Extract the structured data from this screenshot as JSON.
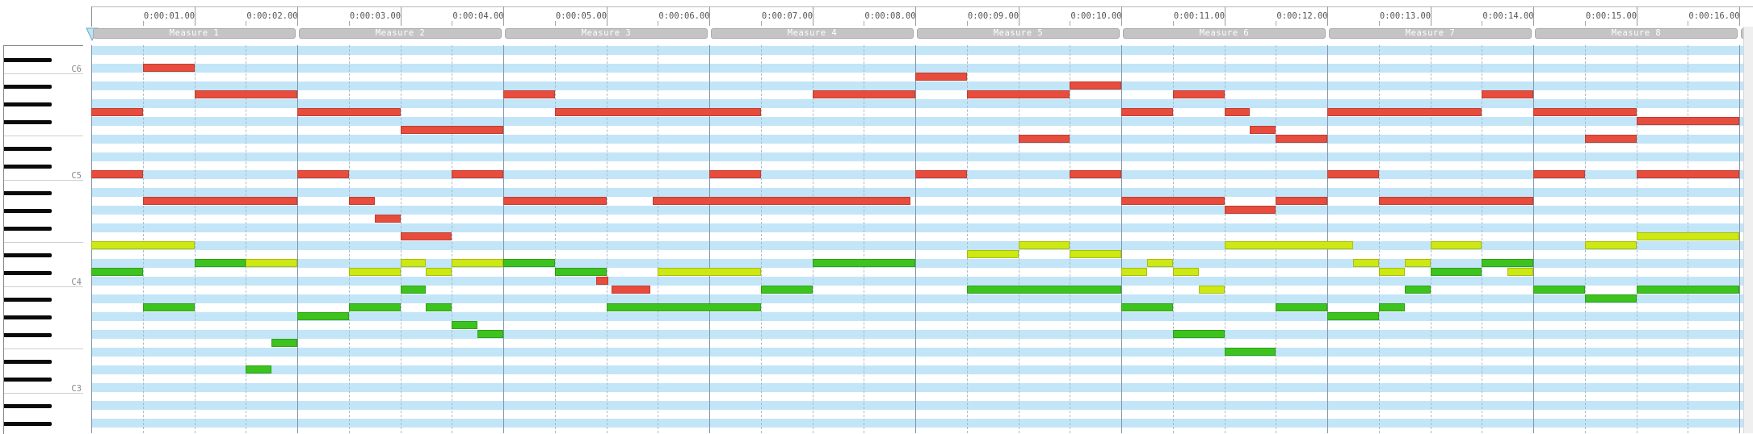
{
  "ruler": {
    "time_labels": [
      "0:00:01.00",
      "0:00:02.00",
      "0:00:03.00",
      "0:00:04.00",
      "0:00:05.00",
      "0:00:06.00",
      "0:00:07.00",
      "0:00:08.00",
      "0:00:09.00",
      "0:00:10.00",
      "0:00:11.00",
      "0:00:12.00",
      "0:00:13.00",
      "0:00:14.00",
      "0:00:15.00",
      "0:00:16.00"
    ]
  },
  "measures": [
    "Measure 1",
    "Measure 2",
    "Measure 3",
    "Measure 4",
    "Measure 5",
    "Measure 6",
    "Measure 7",
    "Measure 8"
  ],
  "keyboard": {
    "octave_labels": [
      "C6",
      "C5",
      "C4",
      "C3"
    ]
  },
  "colors": {
    "note_red": "#e84c3d",
    "note_green": "#3cc31e",
    "note_yellow": "#cde812",
    "row_stripe": "#c3e5f8"
  },
  "notes": [
    {
      "track": "red",
      "start": 0.5,
      "dur": 0.5,
      "pitch": "C6"
    },
    {
      "track": "red",
      "start": 1.0,
      "dur": 1.0,
      "pitch": "A5"
    },
    {
      "track": "red",
      "start": 0.0,
      "dur": 0.5,
      "pitch": "G5"
    },
    {
      "track": "red",
      "start": 0.0,
      "dur": 0.5,
      "pitch": "C5"
    },
    {
      "track": "red",
      "start": 0.5,
      "dur": 1.5,
      "pitch": "A4"
    },
    {
      "track": "red",
      "start": 2.0,
      "dur": 1.0,
      "pitch": "G5"
    },
    {
      "track": "red",
      "start": 3.0,
      "dur": 1.0,
      "pitch": "F5"
    },
    {
      "track": "red",
      "start": 2.0,
      "dur": 0.5,
      "pitch": "C5"
    },
    {
      "track": "red",
      "start": 3.5,
      "dur": 0.5,
      "pitch": "C5"
    },
    {
      "track": "red",
      "start": 2.5,
      "dur": 0.25,
      "pitch": "A4"
    },
    {
      "track": "red",
      "start": 2.75,
      "dur": 0.25,
      "pitch": "G4"
    },
    {
      "track": "red",
      "start": 3.0,
      "dur": 0.5,
      "pitch": "F4"
    },
    {
      "track": "red",
      "start": 4.0,
      "dur": 0.5,
      "pitch": "A5"
    },
    {
      "track": "red",
      "start": 4.5,
      "dur": 2.0,
      "pitch": "G5"
    },
    {
      "track": "red",
      "start": 6.0,
      "dur": 0.5,
      "pitch": "C5"
    },
    {
      "track": "red",
      "start": 4.0,
      "dur": 1.0,
      "pitch": "A4"
    },
    {
      "track": "red",
      "start": 5.45,
      "dur": 2.5,
      "pitch": "A4"
    },
    {
      "track": "red",
      "start": 4.9,
      "dur": 0.12,
      "pitch": "C4"
    },
    {
      "track": "red",
      "start": 5.05,
      "dur": 0.38,
      "pitch": "B3"
    },
    {
      "track": "red",
      "start": 7.0,
      "dur": 1.0,
      "pitch": "A5"
    },
    {
      "track": "red",
      "start": 8.0,
      "dur": 0.5,
      "pitch": "B5"
    },
    {
      "track": "red",
      "start": 8.5,
      "dur": 1.0,
      "pitch": "A5"
    },
    {
      "track": "red",
      "start": 9.5,
      "dur": 0.5,
      "pitch": "A#5"
    },
    {
      "track": "red",
      "start": 9.0,
      "dur": 0.5,
      "pitch": "E5"
    },
    {
      "track": "red",
      "start": 8.0,
      "dur": 0.5,
      "pitch": "C5"
    },
    {
      "track": "red",
      "start": 9.5,
      "dur": 0.5,
      "pitch": "C5"
    },
    {
      "track": "red",
      "start": 10.0,
      "dur": 0.5,
      "pitch": "G5"
    },
    {
      "track": "red",
      "start": 10.5,
      "dur": 0.5,
      "pitch": "A5"
    },
    {
      "track": "red",
      "start": 11.0,
      "dur": 0.25,
      "pitch": "G5"
    },
    {
      "track": "red",
      "start": 11.25,
      "dur": 0.25,
      "pitch": "F5"
    },
    {
      "track": "red",
      "start": 11.5,
      "dur": 0.5,
      "pitch": "E5"
    },
    {
      "track": "red",
      "start": 10.0,
      "dur": 1.0,
      "pitch": "A4"
    },
    {
      "track": "red",
      "start": 11.0,
      "dur": 0.5,
      "pitch": "G#4"
    },
    {
      "track": "red",
      "start": 11.5,
      "dur": 0.5,
      "pitch": "A4"
    },
    {
      "track": "red",
      "start": 12.0,
      "dur": 1.5,
      "pitch": "G5"
    },
    {
      "track": "red",
      "start": 13.5,
      "dur": 0.5,
      "pitch": "A5"
    },
    {
      "track": "red",
      "start": 12.0,
      "dur": 0.5,
      "pitch": "C5"
    },
    {
      "track": "red",
      "start": 12.5,
      "dur": 1.5,
      "pitch": "A4"
    },
    {
      "track": "red",
      "start": 14.0,
      "dur": 1.0,
      "pitch": "G5"
    },
    {
      "track": "red",
      "start": 15.0,
      "dur": 1.0,
      "pitch": "F#5"
    },
    {
      "track": "red",
      "start": 14.5,
      "dur": 0.5,
      "pitch": "E5"
    },
    {
      "track": "red",
      "start": 14.0,
      "dur": 0.5,
      "pitch": "C5"
    },
    {
      "track": "red",
      "start": 15.0,
      "dur": 1.0,
      "pitch": "C5"
    },
    {
      "track": "yellow",
      "start": 0.0,
      "dur": 1.0,
      "pitch": "E4"
    },
    {
      "track": "yellow",
      "start": 1.5,
      "dur": 0.5,
      "pitch": "D4"
    },
    {
      "track": "yellow",
      "start": 2.5,
      "dur": 0.5,
      "pitch": "C#4"
    },
    {
      "track": "yellow",
      "start": 3.0,
      "dur": 0.25,
      "pitch": "D4"
    },
    {
      "track": "yellow",
      "start": 3.25,
      "dur": 0.25,
      "pitch": "C#4"
    },
    {
      "track": "yellow",
      "start": 3.5,
      "dur": 0.5,
      "pitch": "D4"
    },
    {
      "track": "yellow",
      "start": 5.5,
      "dur": 1.0,
      "pitch": "C#4"
    },
    {
      "track": "yellow",
      "start": 8.5,
      "dur": 0.5,
      "pitch": "D#4"
    },
    {
      "track": "yellow",
      "start": 9.0,
      "dur": 0.5,
      "pitch": "E4"
    },
    {
      "track": "yellow",
      "start": 9.5,
      "dur": 0.5,
      "pitch": "D#4"
    },
    {
      "track": "yellow",
      "start": 10.0,
      "dur": 0.25,
      "pitch": "C#4"
    },
    {
      "track": "yellow",
      "start": 10.25,
      "dur": 0.25,
      "pitch": "D4"
    },
    {
      "track": "yellow",
      "start": 10.5,
      "dur": 0.25,
      "pitch": "C#4"
    },
    {
      "track": "yellow",
      "start": 10.75,
      "dur": 0.25,
      "pitch": "B3"
    },
    {
      "track": "yellow",
      "start": 11.0,
      "dur": 1.25,
      "pitch": "E4"
    },
    {
      "track": "yellow",
      "start": 12.25,
      "dur": 0.25,
      "pitch": "D4"
    },
    {
      "track": "yellow",
      "start": 12.5,
      "dur": 0.25,
      "pitch": "C#4"
    },
    {
      "track": "yellow",
      "start": 12.75,
      "dur": 0.25,
      "pitch": "D4"
    },
    {
      "track": "yellow",
      "start": 13.0,
      "dur": 0.5,
      "pitch": "E4"
    },
    {
      "track": "yellow",
      "start": 13.75,
      "dur": 0.25,
      "pitch": "C#4"
    },
    {
      "track": "yellow",
      "start": 14.5,
      "dur": 0.5,
      "pitch": "E4"
    },
    {
      "track": "yellow",
      "start": 15.0,
      "dur": 1.0,
      "pitch": "F4"
    },
    {
      "track": "green",
      "start": 0.0,
      "dur": 0.5,
      "pitch": "C#4"
    },
    {
      "track": "green",
      "start": 1.0,
      "dur": 0.5,
      "pitch": "D4"
    },
    {
      "track": "green",
      "start": 0.5,
      "dur": 0.5,
      "pitch": "A3"
    },
    {
      "track": "green",
      "start": 1.75,
      "dur": 0.25,
      "pitch": "F3"
    },
    {
      "track": "green",
      "start": 1.5,
      "dur": 0.25,
      "pitch": "D3"
    },
    {
      "track": "green",
      "start": 2.0,
      "dur": 0.5,
      "pitch": "G#3"
    },
    {
      "track": "green",
      "start": 2.5,
      "dur": 0.5,
      "pitch": "A3"
    },
    {
      "track": "green",
      "start": 3.0,
      "dur": 0.25,
      "pitch": "B3"
    },
    {
      "track": "green",
      "start": 3.25,
      "dur": 0.25,
      "pitch": "A3"
    },
    {
      "track": "green",
      "start": 3.5,
      "dur": 0.25,
      "pitch": "G3"
    },
    {
      "track": "green",
      "start": 3.75,
      "dur": 0.25,
      "pitch": "F#3"
    },
    {
      "track": "green",
      "start": 4.0,
      "dur": 0.5,
      "pitch": "D4"
    },
    {
      "track": "green",
      "start": 4.5,
      "dur": 0.5,
      "pitch": "C#4"
    },
    {
      "track": "green",
      "start": 5.0,
      "dur": 1.5,
      "pitch": "A3"
    },
    {
      "track": "green",
      "start": 6.5,
      "dur": 0.5,
      "pitch": "B3"
    },
    {
      "track": "green",
      "start": 7.0,
      "dur": 1.0,
      "pitch": "D4"
    },
    {
      "track": "green",
      "start": 8.5,
      "dur": 1.5,
      "pitch": "B3"
    },
    {
      "track": "green",
      "start": 10.0,
      "dur": 0.5,
      "pitch": "A3"
    },
    {
      "track": "green",
      "start": 10.5,
      "dur": 0.5,
      "pitch": "F#3"
    },
    {
      "track": "green",
      "start": 11.0,
      "dur": 0.5,
      "pitch": "E3"
    },
    {
      "track": "green",
      "start": 11.5,
      "dur": 0.5,
      "pitch": "A3"
    },
    {
      "track": "green",
      "start": 12.0,
      "dur": 0.5,
      "pitch": "G#3"
    },
    {
      "track": "green",
      "start": 12.5,
      "dur": 0.25,
      "pitch": "A3"
    },
    {
      "track": "green",
      "start": 12.75,
      "dur": 0.25,
      "pitch": "B3"
    },
    {
      "track": "green",
      "start": 13.0,
      "dur": 0.5,
      "pitch": "C#4"
    },
    {
      "track": "green",
      "start": 13.5,
      "dur": 0.5,
      "pitch": "D4"
    },
    {
      "track": "green",
      "start": 14.0,
      "dur": 0.5,
      "pitch": "B3"
    },
    {
      "track": "green",
      "start": 14.5,
      "dur": 0.5,
      "pitch": "A#3"
    },
    {
      "track": "green",
      "start": 15.0,
      "dur": 1.0,
      "pitch": "B3"
    }
  ]
}
